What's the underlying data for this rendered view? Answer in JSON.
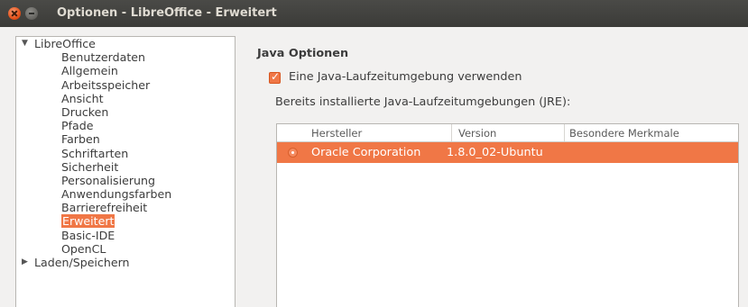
{
  "window": {
    "title": "Optionen - LibreOffice - Erweitert",
    "close_icon": "close-icon",
    "minimize_icon": "minimize-icon"
  },
  "tree": {
    "root_label": "LibreOffice",
    "root_state": "expanded",
    "items": [
      {
        "label": "Benutzerdaten"
      },
      {
        "label": "Allgemein"
      },
      {
        "label": "Arbeitsspeicher"
      },
      {
        "label": "Ansicht"
      },
      {
        "label": "Drucken"
      },
      {
        "label": "Pfade"
      },
      {
        "label": "Farben"
      },
      {
        "label": "Schriftarten"
      },
      {
        "label": "Sicherheit"
      },
      {
        "label": "Personalisierung"
      },
      {
        "label": "Anwendungsfarben"
      },
      {
        "label": "Barrierefreiheit"
      },
      {
        "label": "Erweitert",
        "selected": true
      },
      {
        "label": "Basic-IDE"
      },
      {
        "label": "OpenCL"
      }
    ],
    "next_root_label": "Laden/Speichern",
    "next_root_state": "collapsed"
  },
  "java_options": {
    "heading": "Java Optionen",
    "use_jre_label": "Eine Java-Laufzeitumgebung verwenden",
    "use_jre_checked": true,
    "installed_label": "Bereits installierte Java-Laufzeitumgebungen (JRE):",
    "table": {
      "columns": [
        "Hersteller",
        "Version",
        "Besondere Merkmale"
      ],
      "rows": [
        {
          "vendor": "Oracle Corporation",
          "version": "1.8.0_02-Ubuntu",
          "features": "",
          "selected": true
        }
      ]
    }
  },
  "colors": {
    "accent": "#f07746",
    "titlebar": "#3f3f3c",
    "background": "#f2f1f0"
  }
}
